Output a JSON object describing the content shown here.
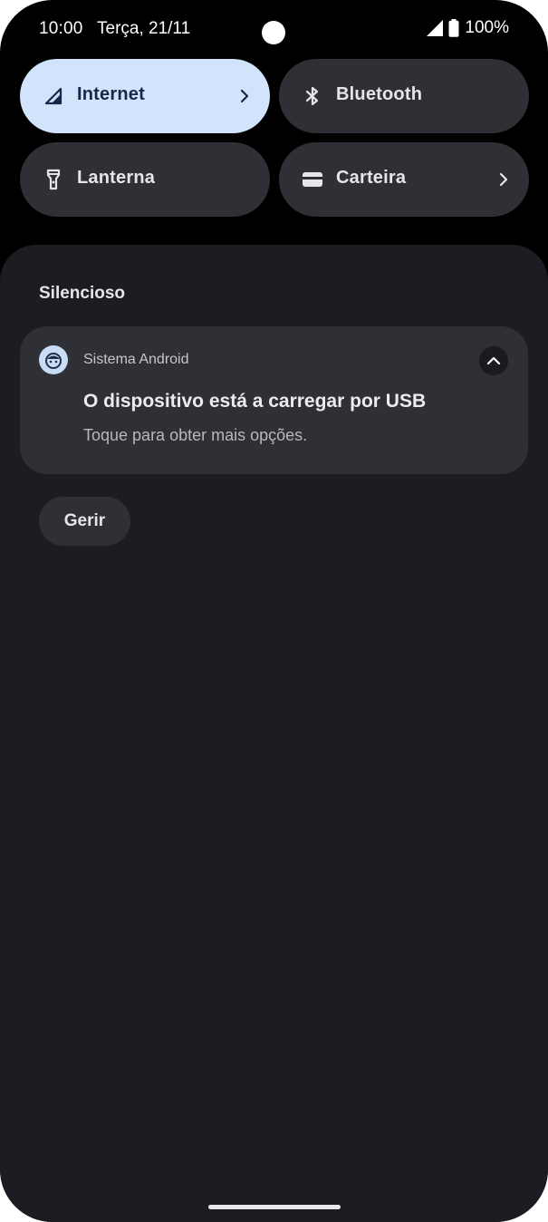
{
  "status_bar": {
    "time": "10:00",
    "date": "Terça, 21/11",
    "battery": "100%",
    "icons": [
      "signal-icon",
      "battery-icon"
    ]
  },
  "quick_tiles": [
    {
      "label": "Internet",
      "icon": "signal-icon",
      "active": true,
      "has_chevron": true
    },
    {
      "label": "Bluetooth",
      "icon": "bluetooth-icon",
      "active": false,
      "has_chevron": false
    },
    {
      "label": "Lanterna",
      "icon": "flashlight-icon",
      "active": false,
      "has_chevron": false
    },
    {
      "label": "Carteira",
      "icon": "wallet-icon",
      "active": false,
      "has_chevron": true
    }
  ],
  "notifications": {
    "section_title": "Silencioso",
    "items": [
      {
        "app_name": "Sistema Android",
        "app_icon": "android-icon",
        "title": "O dispositivo está a carregar por USB",
        "text": "Toque para obter mais opções."
      }
    ],
    "manage_label": "Gerir"
  },
  "colors": {
    "background": "#000000",
    "shade": "#1c1d22",
    "tile": "#2e3035",
    "tile_active": "#d2e4fb",
    "text_primary": "#e6e6ea"
  }
}
